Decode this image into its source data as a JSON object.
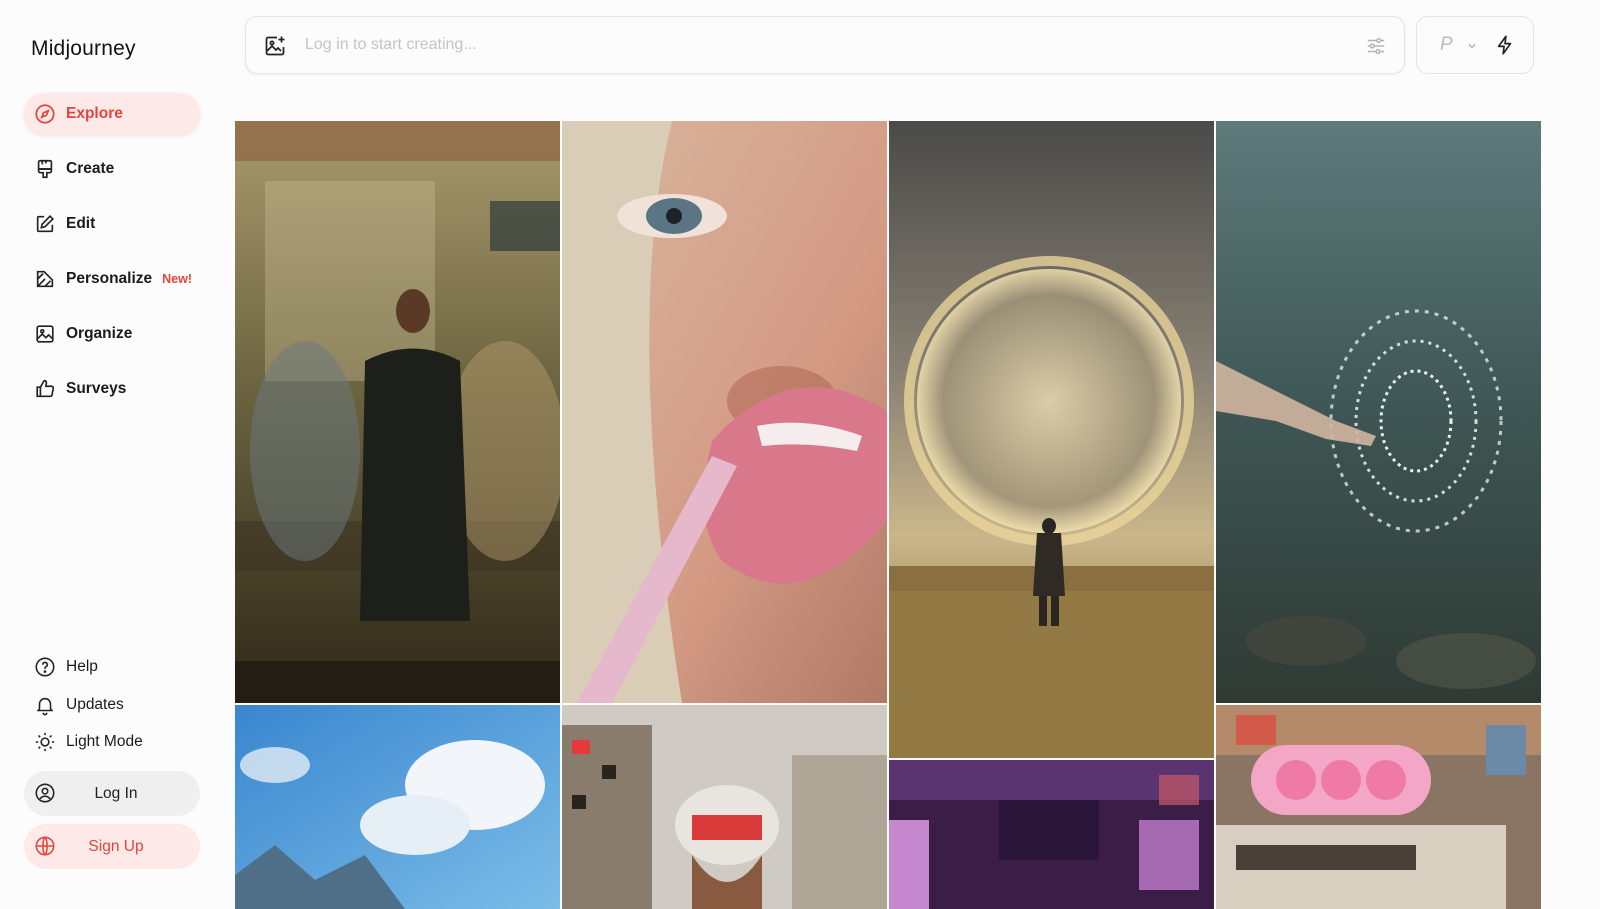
{
  "app": {
    "brand": "Midjourney"
  },
  "nav": {
    "items": [
      {
        "label": "Explore",
        "icon": "compass-icon"
      },
      {
        "label": "Create",
        "icon": "brush-icon"
      },
      {
        "label": "Edit",
        "icon": "edit-icon"
      },
      {
        "label": "Personalize",
        "icon": "personalize-icon",
        "badge": "New!"
      },
      {
        "label": "Organize",
        "icon": "image-icon"
      },
      {
        "label": "Surveys",
        "icon": "thumbs-up-icon"
      }
    ]
  },
  "bottom": {
    "help": "Help",
    "updates": "Updates",
    "light_mode": "Light Mode",
    "login": "Log In",
    "signup": "Sign Up"
  },
  "prompt": {
    "placeholder": "Log in to start creating...",
    "version_label": "P"
  },
  "colors": {
    "accent": "#e2453a",
    "accent_bg": "#fde9e8",
    "background": "#fcfcfc"
  },
  "gallery": [
    {
      "name": "subway-photo"
    },
    {
      "name": "lip-gloss-photo"
    },
    {
      "name": "sky-portal-photo"
    },
    {
      "name": "water-hand-photo"
    },
    {
      "name": "anime-sky-photo"
    },
    {
      "name": "red-helmet-photo"
    },
    {
      "name": "neon-train-photo"
    },
    {
      "name": "pink-boombox-photo"
    }
  ]
}
